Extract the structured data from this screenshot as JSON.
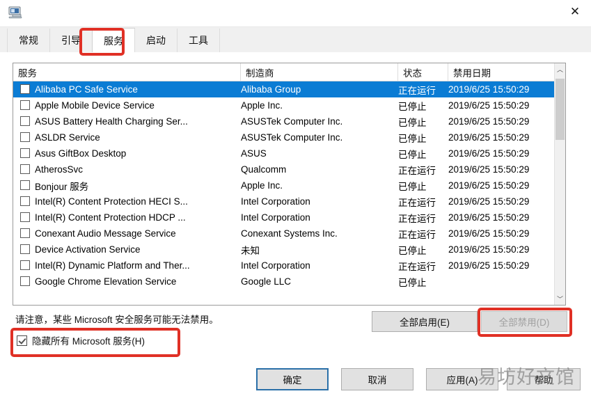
{
  "window": {
    "icon": "msconfig-computer-icon",
    "title": "",
    "close_label": "✕"
  },
  "tabs": [
    {
      "label": "常规",
      "selected": false
    },
    {
      "label": "引导",
      "selected": false
    },
    {
      "label": "服务",
      "selected": true
    },
    {
      "label": "启动",
      "selected": false
    },
    {
      "label": "工具",
      "selected": false
    }
  ],
  "list": {
    "columns": [
      {
        "label": "服务"
      },
      {
        "label": "制造商"
      },
      {
        "label": "状态"
      },
      {
        "label": "禁用日期"
      }
    ],
    "rows": [
      {
        "name": "Alibaba PC Safe Service",
        "manufacturer": "Alibaba Group",
        "state": "正在运行",
        "date": "2019/6/25 15:50:29",
        "checked": false,
        "selected": true
      },
      {
        "name": "Apple Mobile Device Service",
        "manufacturer": "Apple Inc.",
        "state": "已停止",
        "date": "2019/6/25 15:50:29",
        "checked": false,
        "selected": false
      },
      {
        "name": "ASUS Battery Health Charging Ser...",
        "manufacturer": "ASUSTek Computer Inc.",
        "state": "已停止",
        "date": "2019/6/25 15:50:29",
        "checked": false,
        "selected": false
      },
      {
        "name": "ASLDR Service",
        "manufacturer": "ASUSTek Computer Inc.",
        "state": "已停止",
        "date": "2019/6/25 15:50:29",
        "checked": false,
        "selected": false
      },
      {
        "name": "Asus GiftBox Desktop",
        "manufacturer": "ASUS",
        "state": "已停止",
        "date": "2019/6/25 15:50:29",
        "checked": false,
        "selected": false
      },
      {
        "name": "AtherosSvc",
        "manufacturer": "Qualcomm",
        "state": "正在运行",
        "date": "2019/6/25 15:50:29",
        "checked": false,
        "selected": false
      },
      {
        "name": "Bonjour 服务",
        "manufacturer": "Apple Inc.",
        "state": "已停止",
        "date": "2019/6/25 15:50:29",
        "checked": false,
        "selected": false
      },
      {
        "name": "Intel(R) Content Protection HECI S...",
        "manufacturer": "Intel Corporation",
        "state": "正在运行",
        "date": "2019/6/25 15:50:29",
        "checked": false,
        "selected": false
      },
      {
        "name": "Intel(R) Content Protection HDCP ...",
        "manufacturer": "Intel Corporation",
        "state": "正在运行",
        "date": "2019/6/25 15:50:29",
        "checked": false,
        "selected": false
      },
      {
        "name": "Conexant Audio Message Service",
        "manufacturer": "Conexant Systems Inc.",
        "state": "正在运行",
        "date": "2019/6/25 15:50:29",
        "checked": false,
        "selected": false
      },
      {
        "name": "Device Activation Service",
        "manufacturer": "未知",
        "state": "已停止",
        "date": "2019/6/25 15:50:29",
        "checked": false,
        "selected": false
      },
      {
        "name": "Intel(R) Dynamic Platform and Ther...",
        "manufacturer": "Intel Corporation",
        "state": "正在运行",
        "date": "2019/6/25 15:50:29",
        "checked": false,
        "selected": false
      },
      {
        "name": "Google Chrome Elevation Service",
        "manufacturer": "Google LLC",
        "state": "已停止",
        "date": "",
        "checked": false,
        "selected": false
      }
    ],
    "scrollbar": {
      "up_arrow": "︿",
      "down_arrow": "﹀"
    }
  },
  "note": "请注意，某些 Microsoft 安全服务可能无法禁用。",
  "hide_microsoft": {
    "label": "隐藏所有 Microsoft 服务(H)",
    "checked": true
  },
  "buttons": {
    "enable_all": "全部启用(E)",
    "disable_all": "全部禁用(D)",
    "ok": "确定",
    "cancel": "取消",
    "apply": "应用(A)",
    "help": "帮助"
  },
  "watermark": "易坊好文馆",
  "colors": {
    "selection_blue": "#0b7cd4",
    "annotation_red": "#e03025",
    "default_button_border": "#2a6fa8"
  }
}
